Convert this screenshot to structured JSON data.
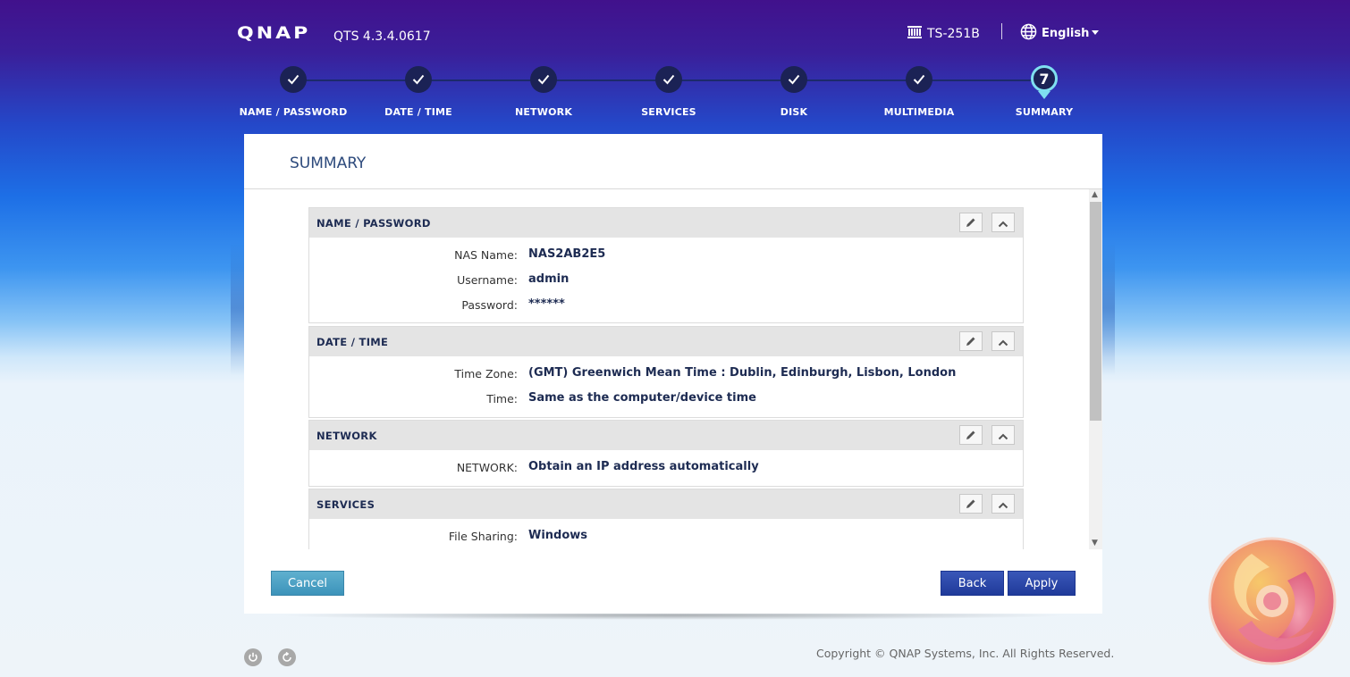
{
  "header": {
    "logo": "QNAP",
    "version": "QTS 4.3.4.0617",
    "device": "TS-251B",
    "language": "English"
  },
  "steps": [
    {
      "label": "NAME / PASSWORD",
      "done": true
    },
    {
      "label": "DATE / TIME",
      "done": true
    },
    {
      "label": "NETWORK",
      "done": true
    },
    {
      "label": "SERVICES",
      "done": true
    },
    {
      "label": "DISK",
      "done": true
    },
    {
      "label": "MULTIMEDIA",
      "done": true
    },
    {
      "label": "SUMMARY",
      "number": "7",
      "active": true
    }
  ],
  "panel": {
    "title": "SUMMARY",
    "sections": [
      {
        "title": "NAME / PASSWORD",
        "rows": [
          {
            "key": "NAS Name:",
            "value": "NAS2AB2E5"
          },
          {
            "key": "Username:",
            "value": "admin"
          },
          {
            "key": "Password:",
            "value": "******"
          }
        ]
      },
      {
        "title": "DATE / TIME",
        "rows": [
          {
            "key": "Time Zone:",
            "value": "(GMT) Greenwich Mean Time : Dublin, Edinburgh, Lisbon, London"
          },
          {
            "key": "Time:",
            "value": "Same as the computer/device time"
          }
        ]
      },
      {
        "title": "NETWORK",
        "rows": [
          {
            "key": "NETWORK:",
            "value": "Obtain an IP address automatically"
          }
        ]
      },
      {
        "title": "SERVICES",
        "rows": [
          {
            "key": "File Sharing:",
            "value": "Windows"
          }
        ]
      }
    ],
    "buttons": {
      "cancel": "Cancel",
      "back": "Back",
      "apply": "Apply"
    }
  },
  "footer": {
    "copyright": "Copyright © QNAP Systems, Inc. All Rights Reserved."
  },
  "colors": {
    "header_purple": "#41118c",
    "step_circle": "#1b2255",
    "active_ring": "#7fe0f0",
    "primary_button": "#1f3a9a",
    "cancel_button": "#3c93ba"
  }
}
